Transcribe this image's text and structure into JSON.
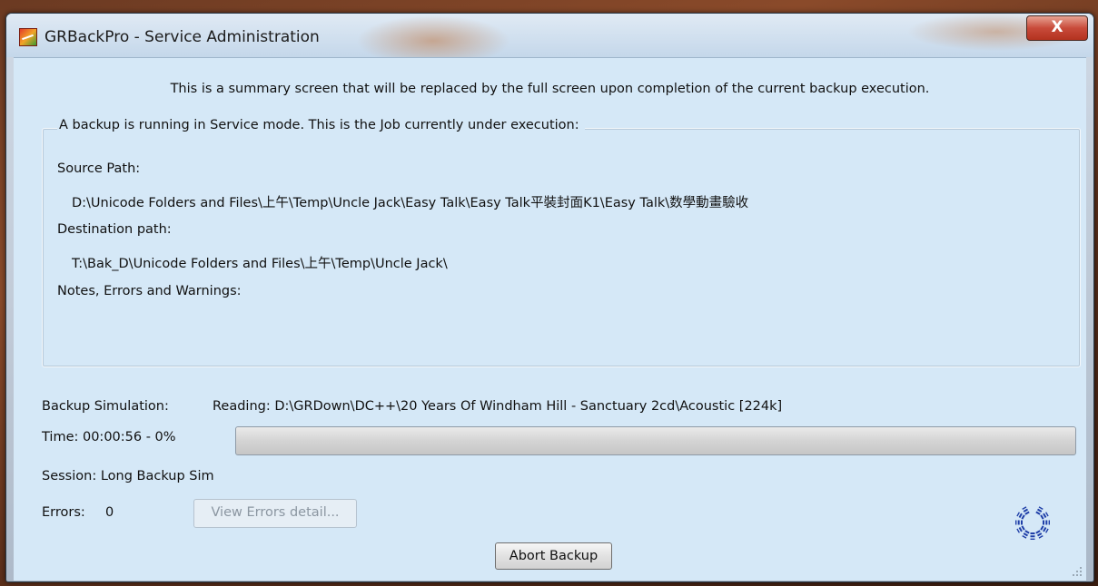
{
  "window": {
    "title": "GRBackPro - Service Administration",
    "close_label": "X"
  },
  "summary_text": "This is a summary screen that will be replaced by the full screen upon completion of the current backup execution.",
  "job_group": {
    "legend": "A backup is running in Service mode. This is the Job currently under execution:",
    "source_label": "Source Path:",
    "source_value": "D:\\Unicode Folders and Files\\上午\\Temp\\Uncle Jack\\Easy Talk\\Easy Talk平裝封面K1\\Easy Talk\\数學動畫驗收",
    "destination_label": "Destination path:",
    "destination_value": "T:\\Bak_D\\Unicode Folders and Files\\上午\\Temp\\Uncle Jack\\",
    "notes_label": "Notes, Errors and Warnings:"
  },
  "status": {
    "simulation_label": "Backup Simulation:",
    "simulation_value": "Reading: D:\\GRDown\\DC++\\20 Years Of Windham Hill - Sanctuary 2cd\\Acoustic [224k]",
    "time_text": "Time:  00:00:56 - 0%",
    "progress_fraction": 0,
    "session_text": "Session:  Long Backup Sim",
    "errors_label": "Errors:",
    "errors_count": "0"
  },
  "buttons": {
    "view_errors": "View Errors detail...",
    "abort": "Abort Backup"
  },
  "icons": {
    "app": "grbackpro-app-icon",
    "busy": "busy-spinner-icon",
    "grip": "resize-grip-icon"
  },
  "colors": {
    "client_bg": "#d5e8f7",
    "spinner": "#1f3fa8",
    "close_button": "#c84b3a"
  }
}
